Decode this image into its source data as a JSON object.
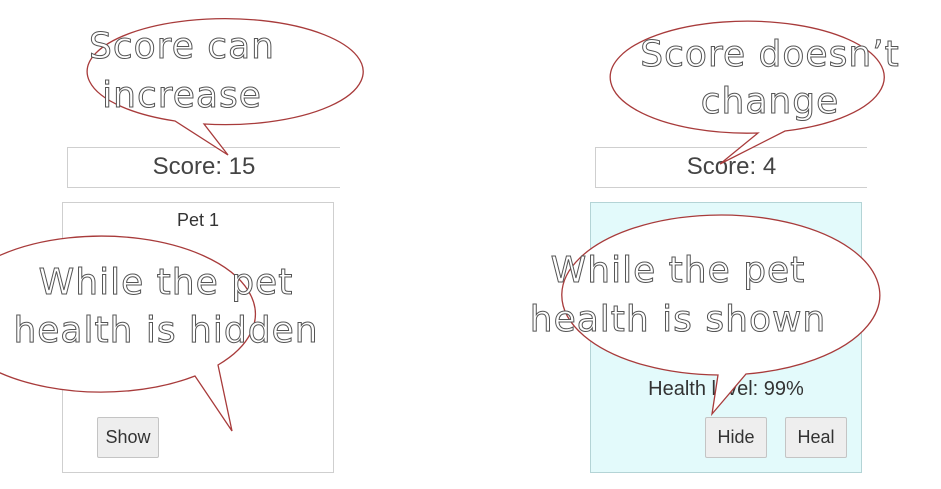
{
  "left_panel": {
    "score_text": "Score: 15",
    "pet_name": "Pet 1",
    "show_label": "Show"
  },
  "right_panel": {
    "score_text": "Score: 4",
    "health_text": "Health level: 99%",
    "hide_label": "Hide",
    "heal_label": "Heal"
  },
  "callouts": {
    "score_increase": [
      "Score can",
      "increase"
    ],
    "score_no_change": [
      "Score doesn’t",
      "change"
    ],
    "health_hidden": [
      "While the pet",
      "health is hidden"
    ],
    "health_shown": [
      "While the pet",
      "health is shown"
    ]
  },
  "colors": {
    "bubble_outline": "#a83b3b",
    "active_card_bg": "#e3fafb",
    "button_bg": "#eeeeee"
  }
}
